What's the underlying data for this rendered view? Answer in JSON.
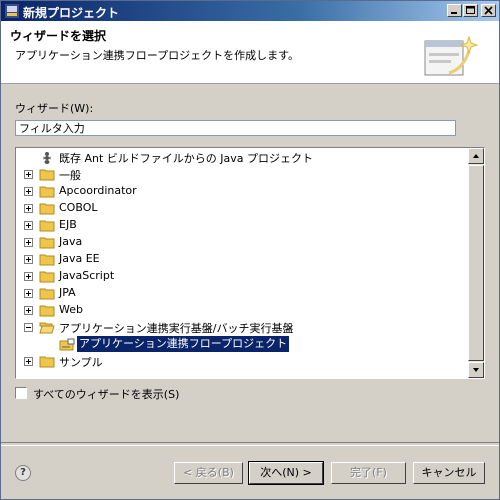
{
  "window": {
    "title": "新規プロジェクト",
    "minimize_icon": "minimize-icon",
    "maximize_icon": "maximize-icon",
    "close_icon": "close-icon"
  },
  "header": {
    "title": "ウィザードを選択",
    "description": "アプリケーション連携フロープロジェクトを作成します。"
  },
  "wizard_label": "ウィザード(W):",
  "filter": {
    "value": "フィルタ入力"
  },
  "tree": {
    "items": [
      {
        "label": "既存 Ant ビルドファイルからの Java プロジェクト",
        "icon": "ant-icon",
        "expander": "none"
      },
      {
        "label": "一般",
        "icon": "folder-icon",
        "expander": "plus"
      },
      {
        "label": "Apcoordinator",
        "icon": "folder-icon",
        "expander": "plus"
      },
      {
        "label": "COBOL",
        "icon": "folder-icon",
        "expander": "plus"
      },
      {
        "label": "EJB",
        "icon": "folder-icon",
        "expander": "plus"
      },
      {
        "label": "Java",
        "icon": "folder-icon",
        "expander": "plus"
      },
      {
        "label": "Java EE",
        "icon": "folder-icon",
        "expander": "plus"
      },
      {
        "label": "JavaScript",
        "icon": "folder-icon",
        "expander": "plus"
      },
      {
        "label": "JPA",
        "icon": "folder-icon",
        "expander": "plus"
      },
      {
        "label": "Web",
        "icon": "folder-icon",
        "expander": "plus"
      },
      {
        "label": "アプリケーション連携実行基盤/バッチ実行基盤",
        "icon": "open-folder-icon",
        "expander": "minus"
      },
      {
        "label": "アプリケーション連携フロープロジェクト",
        "icon": "wizard-item-icon",
        "expander": "none",
        "selected": true
      },
      {
        "label": "サンプル",
        "icon": "folder-icon",
        "expander": "plus"
      }
    ]
  },
  "show_all_label": "すべてのウィザードを表示(S)",
  "buttons": {
    "back": "< 戻る(B)",
    "next": "次へ(N) >",
    "finish": "完了(F)",
    "cancel": "キャンセル"
  },
  "colors": {
    "titlebar": "#0a246a",
    "selection": "#0a246a",
    "dialog_bg": "#d4d0c8",
    "folder": "#f0c64a"
  }
}
